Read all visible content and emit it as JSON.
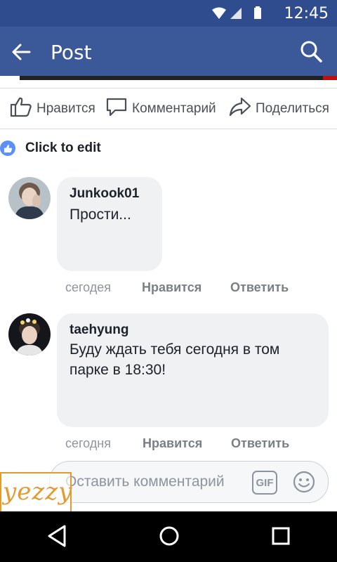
{
  "status_bar": {
    "time": "12:45"
  },
  "app_bar": {
    "title": "Post"
  },
  "actions": {
    "like": "Нравится",
    "comment": "Комментарий",
    "share": "Поделиться"
  },
  "likes": {
    "label": "Click to edit"
  },
  "comments": [
    {
      "author": "Junkook01",
      "text": "Прости...",
      "time": "сегодея",
      "like": "Нравится",
      "reply": "Ответить"
    },
    {
      "author": "taehyung",
      "text": "Буду ждать тебя сегодня в том парке в 18:30!",
      "time": "сегодня",
      "like": "Нравится",
      "reply": "Ответить"
    }
  ],
  "composer": {
    "placeholder": "Оставить комментарий",
    "gif_label": "GIF"
  },
  "watermark": {
    "text": "yezzy"
  },
  "colors": {
    "status_bar": "#2f4d8e",
    "app_bar": "#3b5998",
    "bubble": "#eff1f3",
    "like_badge": "#5b8ff9"
  }
}
